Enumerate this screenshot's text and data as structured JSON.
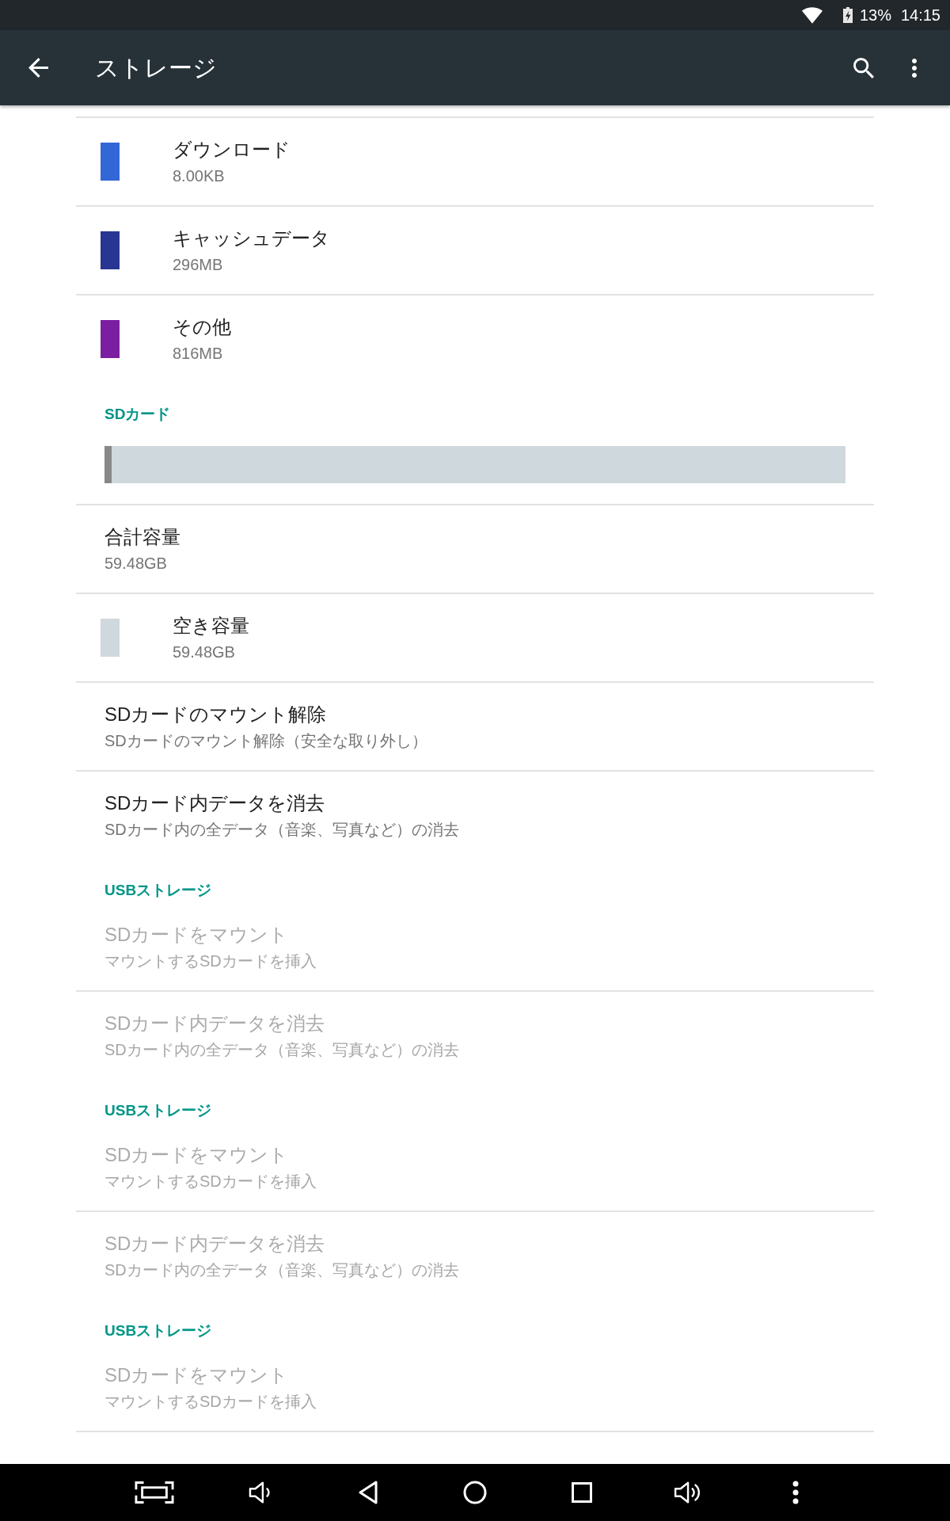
{
  "status_bar": {
    "battery": {
      "charging": true,
      "percent": "13%"
    },
    "time": "14:15"
  },
  "app_bar": {
    "title": "ストレージ"
  },
  "sections": [
    {
      "items": [
        {
          "kind": "swatch",
          "color": "#3367d6",
          "title": "ダウンロード",
          "summary": "8.00KB",
          "disabled": false
        },
        {
          "kind": "swatch",
          "color": "#283593",
          "title": "キャッシュデータ",
          "summary": "296MB",
          "disabled": false
        },
        {
          "kind": "swatch",
          "color": "#7b1fa2",
          "title": "その他",
          "summary": "816MB",
          "disabled": false
        }
      ]
    },
    {
      "header": "SDカード",
      "items": [
        {
          "kind": "bar",
          "level": 0.01,
          "disabled": false
        },
        {
          "kind": "plain",
          "title": "合計容量",
          "summary": "59.48GB",
          "disabled": false
        },
        {
          "kind": "swatch",
          "color": "#cfd8dc",
          "title": "空き容量",
          "summary": "59.48GB",
          "disabled": false
        },
        {
          "kind": "plain",
          "title": "SDカードのマウント解除",
          "summary": "SDカードのマウント解除（安全な取り外し）",
          "disabled": false
        },
        {
          "kind": "plain",
          "title": "SDカード内データを消去",
          "summary": "SDカード内の全データ（音楽、写真など）の消去",
          "disabled": false
        }
      ]
    },
    {
      "header": "USBストレージ",
      "items": [
        {
          "kind": "plain",
          "title": "SDカードをマウント",
          "summary": "マウントするSDカードを挿入",
          "disabled": true
        },
        {
          "kind": "plain",
          "title": "SDカード内データを消去",
          "summary": "SDカード内の全データ（音楽、写真など）の消去",
          "disabled": true
        }
      ]
    },
    {
      "header": "USBストレージ",
      "items": [
        {
          "kind": "plain",
          "title": "SDカードをマウント",
          "summary": "マウントするSDカードを挿入",
          "disabled": true
        },
        {
          "kind": "plain",
          "title": "SDカード内データを消去",
          "summary": "SDカード内の全データ（音楽、写真など）の消去",
          "disabled": true
        }
      ]
    },
    {
      "header": "USBストレージ",
      "items": [
        {
          "kind": "plain",
          "title": "SDカードをマウント",
          "summary": "マウントするSDカードを挿入",
          "disabled": true
        }
      ]
    }
  ]
}
